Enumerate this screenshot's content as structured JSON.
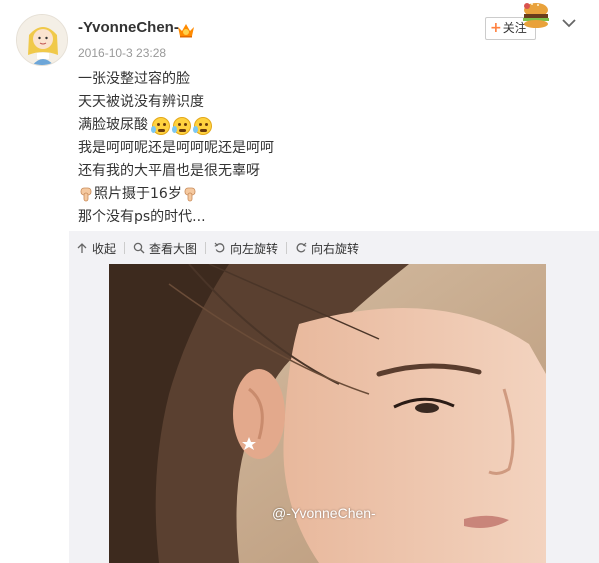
{
  "user": {
    "name": "-YvonneChen-",
    "timestamp": "2016-10-3 23:28"
  },
  "actions": {
    "follow_plus": "+",
    "follow_label": "关注"
  },
  "post": {
    "lines": [
      {
        "text": "一张没整过容的脸"
      },
      {
        "text": "天天被说没有辨识度"
      },
      {
        "text": "满脸玻尿酸"
      },
      {
        "text": "我是呵呵呢还是呵呵呢还是呵呵"
      },
      {
        "text": "还有我的大平眉也是很无辜呀"
      },
      {
        "text": "照片摄于16岁"
      },
      {
        "text": "那个没有ps的时代..."
      }
    ],
    "emoji_icon": "sweat-smile-emoji-icon",
    "finger_icon": "pointing-down-finger-icon"
  },
  "media_toolbar": {
    "collapse": "收起",
    "view_large": "查看大图",
    "rotate_left": "向左旋转",
    "rotate_right": "向右旋转"
  },
  "photo": {
    "watermark": "@-YvonneChen-"
  },
  "colors": {
    "accent": "#ff8140",
    "text": "#333333",
    "muted": "#999999",
    "media_bg": "#f2f2f5"
  }
}
